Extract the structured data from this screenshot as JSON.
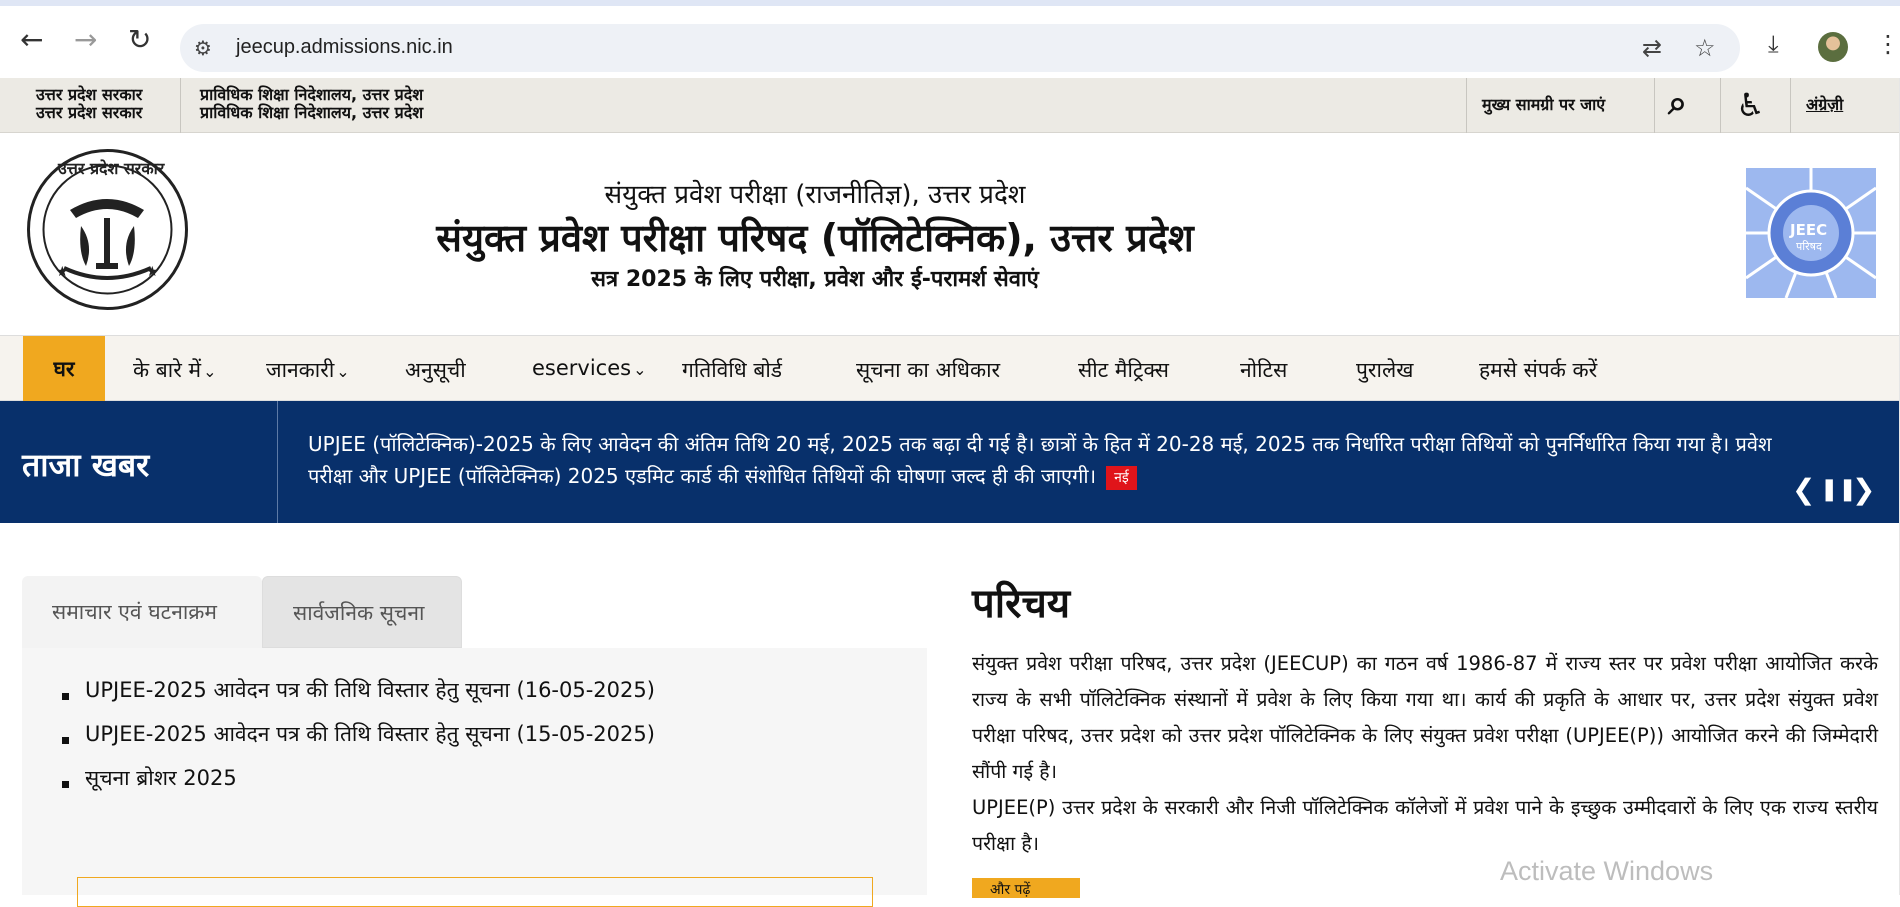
{
  "browser": {
    "url": "jeecup.admissions.nic.in",
    "back_icon": "←",
    "forward_icon": "→",
    "reload_icon": "↻",
    "tune_icon": "⚙",
    "translate_icon": "⇄",
    "star_icon": "☆",
    "download_icon": "⤓",
    "menu_icon": "⋮"
  },
  "govbar": {
    "govt_line1": "उत्तर प्रदेश सरकार",
    "govt_line2": "उत्तर प्रदेश सरकार",
    "dept_line1": "प्राविधिक शिक्षा निदेशालय, उत्तर प्रदेश",
    "dept_line2": "प्राविधिक शिक्षा निदेशालय, उत्तर प्रदेश",
    "skip_link": "मुख्य सामग्री पर जाएं",
    "search_icon": "⌕",
    "accessibility_icon": "♿",
    "language_link": "अंग्रेज़ी"
  },
  "header": {
    "subtitle": "संयुक्त प्रवेश परीक्षा (राजनीतिज्ञ), उत्तर प्रदेश",
    "title": "संयुक्त प्रवेश परीक्षा परिषद (पॉलिटेक्निक), उत्तर प्रदेश",
    "tagline": "सत्र 2025 के लिए परीक्षा, प्रवेश और ई-परामर्श सेवाएं",
    "emblem_text": "उत्तर प्रदेश सरकार",
    "jeec_text": "JEEC",
    "jeec_sub": "परिषद"
  },
  "nav": {
    "items": [
      {
        "label": "घर"
      },
      {
        "label": "के बारे में"
      },
      {
        "label": "जानकारी"
      },
      {
        "label": "अनुसूची"
      },
      {
        "label": "eservices"
      },
      {
        "label": "गतिविधि बोर्ड"
      },
      {
        "label": "सूचना का अधिकार"
      },
      {
        "label": "सीट मैट्रिक्स"
      },
      {
        "label": "नोटिस"
      },
      {
        "label": "पुरालेख"
      },
      {
        "label": "हमसे संपर्क करें"
      }
    ],
    "chevron": "⌄"
  },
  "news": {
    "label": "ताजा खबर",
    "text": "UPJEE (पॉलिटेक्निक)-2025 के लिए आवेदन की अंतिम तिथि 20 मई, 2025 तक बढ़ा दी गई है। छात्रों के हित में 20-28 मई, 2025 तक निर्धारित परीक्षा तिथियों को पुनर्निर्धारित किया गया है। प्रवेश परीक्षा और UPJEE (पॉलिटेक्निक) 2025 एडमिट कार्ड की संशोधित तिथियों की घोषणा जल्द ही की जाएगी।",
    "badge": "नई",
    "prev_icon": "❮",
    "pause_icon": "❚❚",
    "next_icon": "❯"
  },
  "tabs": {
    "tab1": "समाचार एवं घटनाक्रम",
    "tab2": "सार्वजनिक सूचना",
    "items": [
      "UPJEE-2025 आवेदन पत्र की तिथि विस्तार हेतु सूचना (16-05-2025)",
      "UPJEE-2025 आवेदन पत्र की तिथि विस्तार हेतु सूचना (15-05-2025)",
      "सूचना ब्रोशर 2025"
    ]
  },
  "intro": {
    "heading": "परिचय",
    "para1": "संयुक्त प्रवेश परीक्षा परिषद, उत्तर प्रदेश (JEECUP) का गठन वर्ष 1986-87 में राज्य स्तर पर प्रवेश परीक्षा आयोजित करके राज्य के सभी पॉलिटेक्निक संस्थानों में प्रवेश के लिए किया गया था। कार्य की प्रकृति के आधार पर, उत्तर प्रदेश संयुक्त प्रवेश परीक्षा परिषद, उत्तर प्रदेश को उत्तर प्रदेश पॉलिटेक्निक के लिए संयुक्त प्रवेश परीक्षा (UPJEE(P)) आयोजित करने की जिम्मेदारी सौंपी गई है।",
    "para2": "UPJEE(P) उत्तर प्रदेश के सरकारी और निजी पॉलिटेक्निक कॉलेजों में प्रवेश पाने के इच्छुक उम्मीदवारों के लिए एक राज्य स्तरीय परीक्षा है।",
    "read_more": "और पढ़ें"
  },
  "watermark": "Activate Windows",
  "colors": {
    "accent": "#f0a81f",
    "news_bg": "#08306b",
    "badge": "#e0141a"
  }
}
